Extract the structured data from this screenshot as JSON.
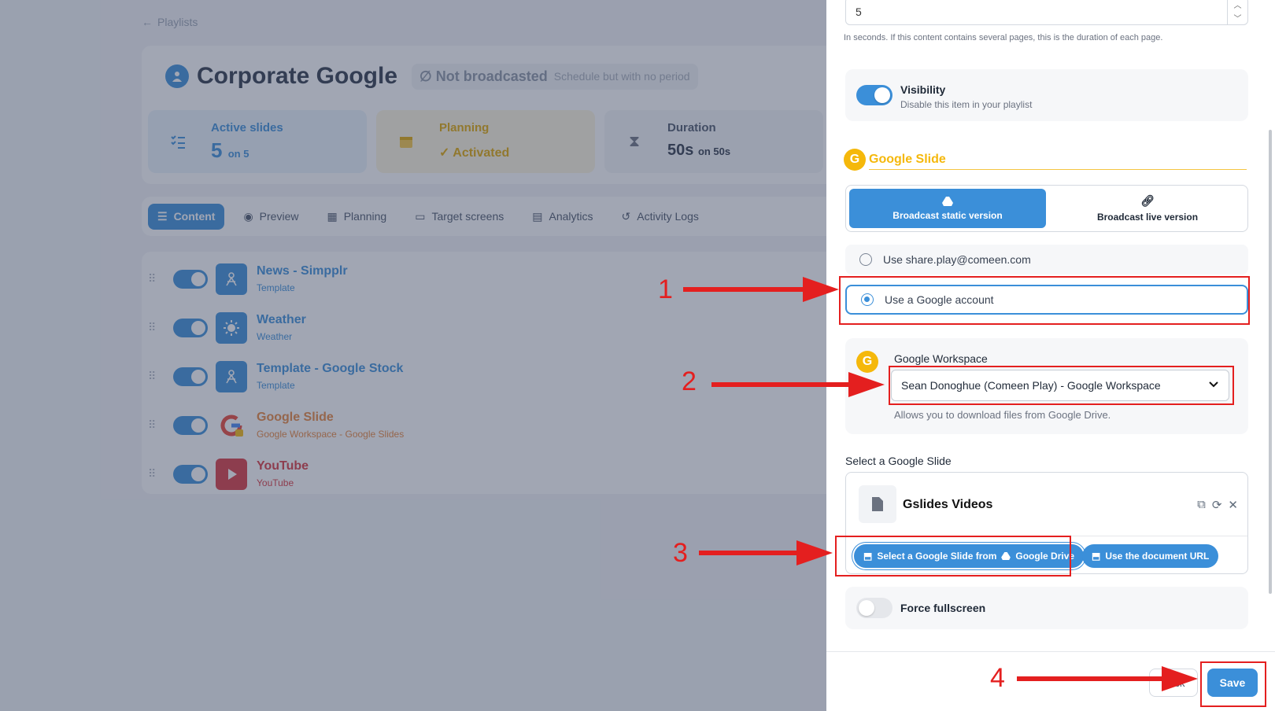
{
  "background": {
    "back_link": "Playlists",
    "title": "Corporate Google",
    "status": "Not broadcasted",
    "status_detail": "Schedule but with no period",
    "stats": [
      {
        "label": "Active slides",
        "value": "5",
        "suffix": "on 5"
      },
      {
        "label": "Planning",
        "value": "Activated"
      },
      {
        "label": "Duration",
        "value": "50s",
        "suffix": "on 50s"
      }
    ],
    "tabs": [
      "Content",
      "Preview",
      "Planning",
      "Target screens",
      "Analytics",
      "Activity Logs"
    ],
    "items": [
      {
        "name": "News - Simpplr",
        "type": "Template",
        "color": "#3b8fd9"
      },
      {
        "name": "Weather",
        "type": "Weather",
        "color": "#3b8fd9"
      },
      {
        "name": "Template - Google Stock",
        "type": "Template",
        "color": "#3b8fd9"
      },
      {
        "name": "Google Slide",
        "type": "Google Workspace - Google Slides",
        "color": "#e8853b"
      },
      {
        "name": "YouTube",
        "type": "YouTube",
        "color": "#d9363e"
      }
    ]
  },
  "drawer": {
    "duration_value": "5",
    "duration_hint": "In seconds. If this content contains several pages, this is the duration of each page.",
    "visibility_label": "Visibility",
    "visibility_hint": "Disable this item in your playlist",
    "visibility_on": true,
    "section_badge": "G",
    "section_title": "Google Slide",
    "broadcast_static": "Broadcast static version",
    "broadcast_live": "Broadcast live version",
    "account_option_1": "Use share.play@comeen.com",
    "account_option_2": "Use a Google account",
    "selected_account_option": 2,
    "workspace_label": "Google Workspace",
    "workspace_value": "Sean Donoghue (Comeen Play) - Google Workspace",
    "workspace_hint": "Allows you to download files from Google Drive.",
    "select_slide_label": "Select a Google Slide",
    "file_name": "Gslides Videos",
    "select_from_drive_prefix": "Select a Google Slide from",
    "select_from_drive_suffix": "Google Drive",
    "use_url": "Use the document URL",
    "force_fullscreen": "Force fullscreen",
    "force_fullscreen_on": false,
    "cancel": "Back",
    "save": "Save"
  },
  "annotations": {
    "steps": [
      "1",
      "2",
      "3",
      "4"
    ],
    "color": "#e41f1f"
  },
  "colors": {
    "accent": "#3b8fd9",
    "google_yellow": "#f5b80b"
  }
}
